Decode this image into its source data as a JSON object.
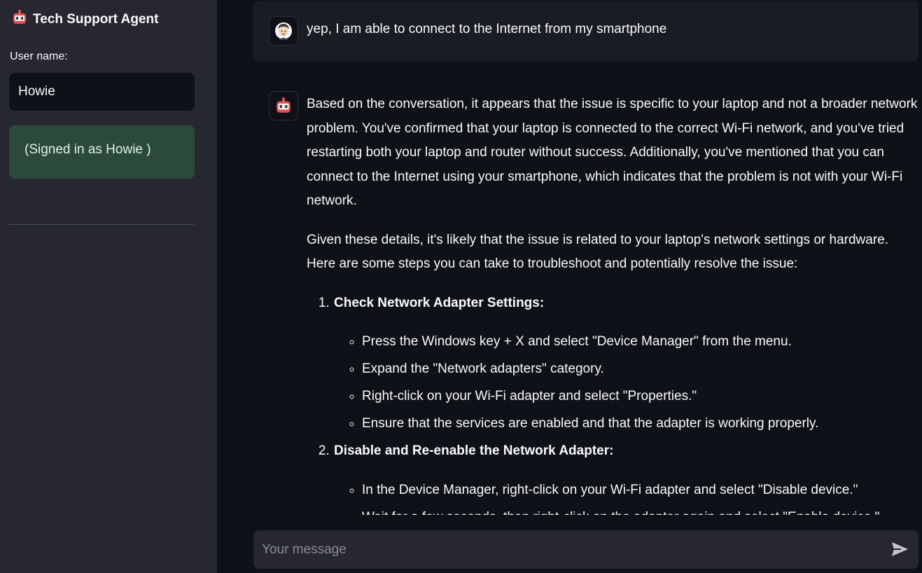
{
  "sidebar": {
    "title": "Tech Support Agent",
    "user_label": "User name:",
    "user_value": "Howie",
    "signed_in_text": "(Signed in as Howie )"
  },
  "messages": {
    "user_text": "yep, I am able to connect to the Internet from my smartphone",
    "bot": {
      "p1": "Based on the conversation, it appears that the issue is specific to your laptop and not a broader network problem. You've confirmed that your laptop is connected to the correct Wi-Fi network, and you've tried restarting both your laptop and router without success. Additionally, you've mentioned that you can connect to the Internet using your smartphone, which indicates that the problem is not with your Wi-Fi network.",
      "p2": "Given these details, it's likely that the issue is related to your laptop's network settings or hardware. Here are some steps you can take to troubleshoot and potentially resolve the issue:",
      "steps": [
        {
          "title": "Check Network Adapter Settings:",
          "items": [
            "Press the Windows key + X and select \"Device Manager\" from the menu.",
            "Expand the \"Network adapters\" category.",
            "Right-click on your Wi-Fi adapter and select \"Properties.\"",
            "Ensure that the services are enabled and that the adapter is working properly."
          ]
        },
        {
          "title": "Disable and Re-enable the Network Adapter:",
          "items": [
            "In the Device Manager, right-click on your Wi-Fi adapter and select \"Disable device.\"",
            "Wait for a few seconds, then right-click on the adapter again and select \"Enable device.\""
          ]
        }
      ]
    }
  },
  "chat_input": {
    "placeholder": "Your message"
  },
  "icons": {
    "app": "robot-icon",
    "user_avatar": "person-avatar-icon",
    "bot_avatar": "robot-icon",
    "send": "send-icon"
  }
}
